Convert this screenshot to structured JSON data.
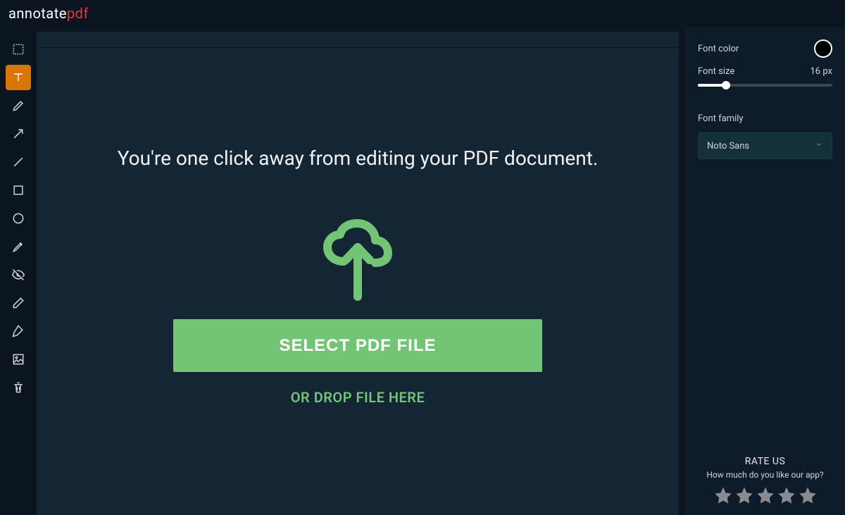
{
  "logo": {
    "part1": "annotate",
    "part2": "pdf"
  },
  "tools": [
    {
      "name": "select-tool",
      "icon": "select",
      "active": false
    },
    {
      "name": "text-tool",
      "icon": "text",
      "active": true
    },
    {
      "name": "pencil-tool",
      "icon": "pencil",
      "active": false
    },
    {
      "name": "arrow-tool",
      "icon": "arrow",
      "active": false
    },
    {
      "name": "line-tool",
      "icon": "line",
      "active": false
    },
    {
      "name": "rectangle-tool",
      "icon": "rectangle",
      "active": false
    },
    {
      "name": "circle-tool",
      "icon": "circle",
      "active": false
    },
    {
      "name": "highlighter-tool",
      "icon": "highlighter",
      "active": false
    },
    {
      "name": "blur-tool",
      "icon": "blur",
      "active": false
    },
    {
      "name": "eraser-tool",
      "icon": "eraser",
      "active": false
    },
    {
      "name": "pen-tool",
      "icon": "pen",
      "active": false
    },
    {
      "name": "image-tool",
      "icon": "image",
      "active": false
    },
    {
      "name": "delete-tool",
      "icon": "trash",
      "active": false
    }
  ],
  "canvas": {
    "headline": "You're one click away from editing your PDF document.",
    "select_button": "SELECT PDF FILE",
    "drop_text": "OR DROP FILE HERE"
  },
  "rightpanel": {
    "font_color_label": "Font color",
    "font_color_value": "#000000",
    "font_size_label": "Font size",
    "font_size_value": "16 px",
    "font_family_label": "Font family",
    "font_family_value": "Noto Sans"
  },
  "rate": {
    "title": "RATE US",
    "subtitle": "How much do you like our app?",
    "stars": 5
  }
}
